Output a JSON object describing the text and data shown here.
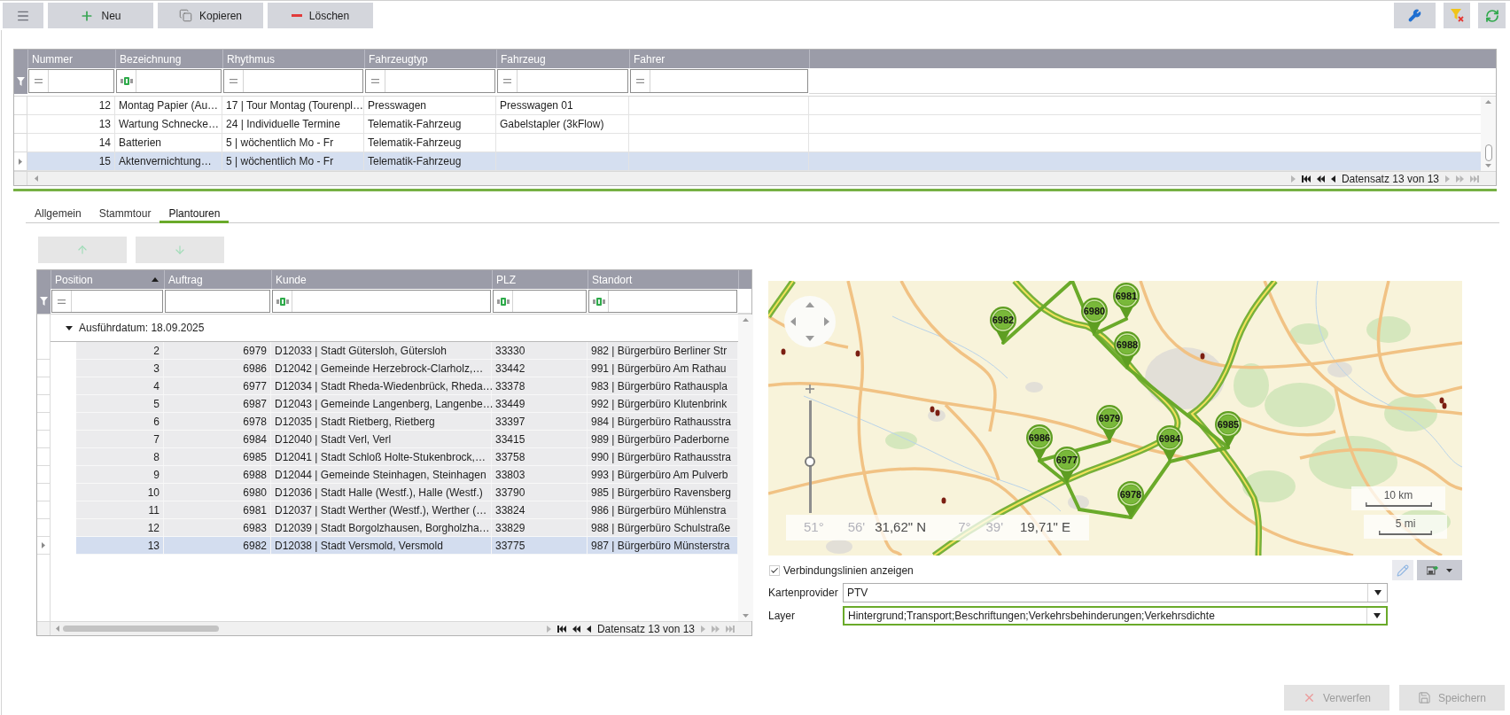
{
  "toolbar": {
    "buttons": [
      {
        "kind": "menu"
      },
      {
        "kind": "add",
        "label": "Neu"
      },
      {
        "kind": "copy",
        "label": "Kopieren"
      },
      {
        "kind": "delete",
        "label": "Löschen"
      }
    ],
    "tools": [
      {
        "kind": "settings"
      },
      {
        "kind": "clear-filter"
      },
      {
        "kind": "refresh"
      }
    ]
  },
  "tours_table": {
    "columns": [
      {
        "label": "Nummer",
        "filter": {
          "kind": "equals"
        }
      },
      {
        "label": "Bezeichnung",
        "filter": {
          "kind": "text"
        }
      },
      {
        "label": "Rhythmus",
        "filter": {
          "kind": "equals"
        }
      },
      {
        "label": "Fahrzeugtyp",
        "filter": {
          "kind": "equals"
        }
      },
      {
        "label": "Fahrzeug",
        "filter": {
          "kind": "equals"
        }
      },
      {
        "label": "Fahrer",
        "filter": {
          "kind": "equals"
        }
      }
    ],
    "rows": [
      {
        "selected": false,
        "cells": [
          "12",
          "Montag Papier (Au…",
          "17 | Tour Montag (Tourenpl…",
          "Presswagen",
          "Presswagen 01"
        ]
      },
      {
        "selected": false,
        "cells": [
          "13",
          "Wartung Schnecke…",
          "24 | Individuelle Termine",
          "Telematik-Fahrzeug",
          "Gabelstapler (3kFlow)"
        ]
      },
      {
        "selected": false,
        "cells": [
          "14",
          "Batterien",
          "5 | wöchentlich Mo - Fr",
          "Telematik-Fahrzeug"
        ]
      },
      {
        "selected": true,
        "cells": [
          "15",
          "Aktenvernichtung…",
          "5 | wöchentlich Mo - Fr",
          "Telematik-Fahrzeug"
        ]
      }
    ],
    "pager": {
      "before": [
        {
          "kind": "expand",
          "disabled": true
        },
        {
          "kind": "first",
          "disabled": false
        },
        {
          "kind": "previous-page",
          "disabled": false
        },
        {
          "kind": "previous",
          "disabled": false
        }
      ],
      "label": "Datensatz 13 von 13",
      "after": [
        {
          "kind": "next",
          "disabled": true
        },
        {
          "kind": "next-page",
          "disabled": true
        },
        {
          "kind": "last",
          "disabled": true
        }
      ]
    }
  },
  "tabs": [
    {
      "label": "Allgemein",
      "selected": false
    },
    {
      "label": "Stammtour",
      "selected": false
    },
    {
      "label": "Plantouren",
      "selected": true
    }
  ],
  "move_buttons": [
    {
      "kind": "up",
      "disabled": true
    },
    {
      "kind": "down",
      "disabled": true
    }
  ],
  "stops_table": {
    "columns": [
      {
        "label": "Position",
        "filter": {
          "kind": "equals"
        },
        "sort_ascending": true
      },
      {
        "label": "Auftrag"
      },
      {
        "label": "Kunde",
        "filter": {
          "kind": "text"
        }
      },
      {
        "label": "PLZ",
        "filter": {
          "kind": "text"
        }
      },
      {
        "label": "Standort",
        "filter": {
          "kind": "text"
        }
      }
    ],
    "group": {
      "label": "Ausführdatum: 18.09.2025",
      "expanded": true
    },
    "rows": [
      {
        "selected": false,
        "cells": [
          "2",
          "6979",
          "D12033 | Stadt Gütersloh, Gütersloh",
          "33330",
          "982 | Bürgerbüro Berliner Str"
        ]
      },
      {
        "selected": false,
        "cells": [
          "3",
          "6986",
          "D12042 | Gemeinde Herzebrock-Clarholz,…",
          "33442",
          "991 | Bürgerbüro Am Rathau"
        ]
      },
      {
        "selected": false,
        "cells": [
          "4",
          "6977",
          "D12034 | Stadt Rheda-Wiedenbrück, Rheda…",
          "33378",
          "983 | Bürgerbüro Rathauspla"
        ]
      },
      {
        "selected": false,
        "cells": [
          "5",
          "6987",
          "D12043 | Gemeinde Langenberg, Langenbe…",
          "33449",
          "992 | Bürgerbüro Klutenbrink"
        ]
      },
      {
        "selected": false,
        "cells": [
          "6",
          "6978",
          "D12035 | Stadt Rietberg, Rietberg",
          "33397",
          "984 | Bürgerbüro Rathausstra"
        ]
      },
      {
        "selected": false,
        "cells": [
          "7",
          "6984",
          "D12040 | Stadt Verl, Verl",
          "33415",
          "989 | Bürgerbüro Paderborne"
        ]
      },
      {
        "selected": false,
        "cells": [
          "8",
          "6985",
          "D12041 | Stadt Schloß Holte-Stukenbrock,…",
          "33758",
          "990 | Bürgerbüro Rathausstra"
        ]
      },
      {
        "selected": false,
        "cells": [
          "9",
          "6988",
          "D12044 | Gemeinde Steinhagen, Steinhagen",
          "33803",
          "993 | Bürgerbüro Am Pulverb"
        ]
      },
      {
        "selected": false,
        "cells": [
          "10",
          "6980",
          "D12036 | Stadt Halle (Westf.), Halle (Westf.)",
          "33790",
          "985 | Bürgerbüro Ravensberg"
        ]
      },
      {
        "selected": false,
        "cells": [
          "11",
          "6981",
          "D12037 | Stadt Werther (Westf.), Werther (…",
          "33824",
          "986 | Bürgerbüro Mühlenstra"
        ]
      },
      {
        "selected": false,
        "cells": [
          "12",
          "6983",
          "D12039 | Stadt Borgolzhausen, Borgholzha…",
          "33829",
          "988 | Bürgerbüro Schulstraße"
        ]
      },
      {
        "selected": true,
        "cells": [
          "13",
          "6982",
          "D12038 | Stadt Versmold, Versmold",
          "33775",
          "987 | Bürgerbüro Münsterstra"
        ]
      }
    ],
    "pager": {
      "before": [
        {
          "kind": "expand",
          "disabled": true
        },
        {
          "kind": "first",
          "disabled": false
        },
        {
          "kind": "previous-page",
          "disabled": false
        },
        {
          "kind": "previous",
          "disabled": false
        }
      ],
      "label": "Datensatz 13 von 13",
      "after": [
        {
          "kind": "next",
          "disabled": true
        },
        {
          "kind": "next-page",
          "disabled": true
        },
        {
          "kind": "last",
          "disabled": true
        }
      ]
    }
  },
  "map": {
    "markers": [
      {
        "label": "6982"
      },
      {
        "label": "6981"
      },
      {
        "label": "6980"
      },
      {
        "label": "6988"
      },
      {
        "label": "6979"
      },
      {
        "label": "6986"
      },
      {
        "label": "6977"
      },
      {
        "label": "6984"
      },
      {
        "label": "6985"
      },
      {
        "label": "6978"
      }
    ],
    "zoom": {
      "level": 0.45
    },
    "coordinates": {
      "latitude": {
        "degrees": "51°",
        "minutes": "56'",
        "seconds": "31,62\" N"
      },
      "longitude": {
        "degrees": "7°",
        "minutes": "39'",
        "seconds": "19,71\" E"
      }
    },
    "scales": [
      {
        "label": "10 km"
      },
      {
        "label": "5 mi"
      }
    ]
  },
  "connection_lines": {
    "label": "Verbindungslinien anzeigen",
    "checked": true
  },
  "map_buttons": [
    {
      "kind": "edit",
      "disabled": true
    },
    {
      "kind": "export",
      "disabled": false
    }
  ],
  "fields": [
    {
      "label": "Kartenprovider",
      "value": "PTV",
      "focused": false
    },
    {
      "label": "Layer",
      "value": "Hintergrund;Transport;Beschriftungen;Verkehrsbehinderungen;Verkehrsdichte",
      "focused": true
    }
  ],
  "actions": [
    {
      "kind": "discard",
      "label": "Verwerfen",
      "disabled": true
    },
    {
      "kind": "save",
      "label": "Speichern",
      "disabled": true
    }
  ]
}
